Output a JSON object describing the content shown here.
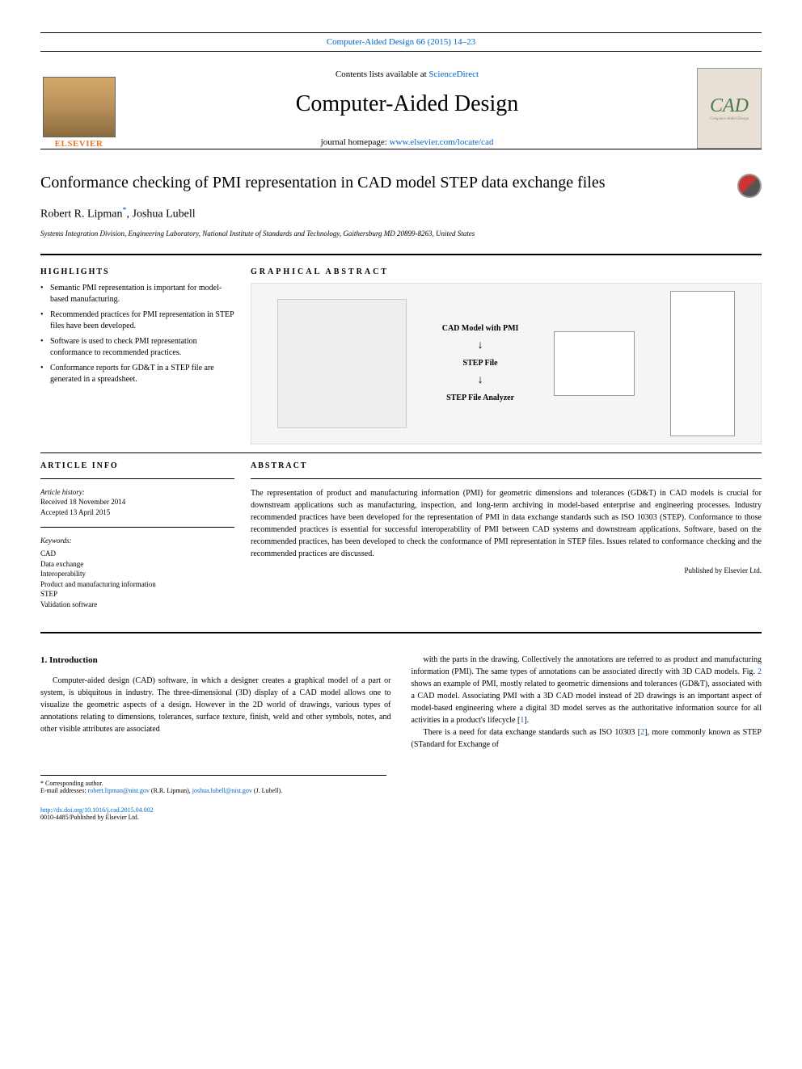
{
  "header": {
    "citation": "Computer-Aided Design 66 (2015) 14–23",
    "contents_prefix": "Contents lists available at ",
    "contents_link": "ScienceDirect",
    "journal_title": "Computer-Aided Design",
    "homepage_prefix": "journal homepage: ",
    "homepage_link": "www.elsevier.com/locate/cad",
    "elsevier_label": "ELSEVIER",
    "cad_logo": "CAD"
  },
  "article": {
    "title": "Conformance checking of PMI representation in CAD model STEP data exchange files",
    "authors": "Robert R. Lipman",
    "corr_mark": "*",
    "author2": ", Joshua Lubell",
    "affiliation": "Systems Integration Division, Engineering Laboratory, National Institute of Standards and Technology, Gaithersburg MD 20899-8263, United States"
  },
  "highlights": {
    "title": "HIGHLIGHTS",
    "items": [
      "Semantic PMI representation is important for model-based manufacturing.",
      "Recommended practices for PMI representation in STEP files have been developed.",
      "Software is used to check PMI representation conformance to recommended practices.",
      "Conformance reports for GD&T in a STEP file are generated in a spreadsheet."
    ]
  },
  "graphical_abstract": {
    "title": "GRAPHICAL ABSTRACT",
    "flow": {
      "step1": "CAD Model with PMI",
      "step2": "STEP File",
      "step3": "STEP File Analyzer"
    }
  },
  "article_info": {
    "title": "ARTICLE INFO",
    "history_label": "Article history:",
    "received": "Received 18 November 2014",
    "accepted": "Accepted 13 April 2015",
    "keywords_label": "Keywords:",
    "keywords": [
      "CAD",
      "Data exchange",
      "Interoperability",
      "Product and manufacturing information",
      "STEP",
      "Validation software"
    ]
  },
  "abstract": {
    "title": "ABSTRACT",
    "text": "The representation of product and manufacturing information (PMI) for geometric dimensions and tolerances (GD&T) in CAD models is crucial for downstream applications such as manufacturing, inspection, and long-term archiving in model-based enterprise and engineering processes. Industry recommended practices have been developed for the representation of PMI in data exchange standards such as ISO 10303 (STEP). Conformance to those recommended practices is essential for successful interoperability of PMI between CAD systems and downstream applications. Software, based on the recommended practices, has been developed to check the conformance of PMI representation in STEP files. Issues related to conformance checking and the recommended practices are discussed.",
    "copyright": "Published by Elsevier Ltd."
  },
  "body": {
    "section1_title": "1. Introduction",
    "para1": "Computer-aided design (CAD) software, in which a designer creates a graphical model of a part or system, is ubiquitous in industry. The three-dimensional (3D) display of a CAD model allows one to visualize the geometric aspects of a design. However in the 2D world of drawings, various types of annotations relating to dimensions, tolerances, surface texture, finish, weld and other symbols, notes, and other visible attributes are associated",
    "ref1": "1",
    "para2": "with the parts in the drawing. Collectively the annotations are referred to as product and manufacturing information (PMI). The same types of annotations can be associated directly with 3D CAD models.",
    "ref2": "2",
    "para2b": " shows an example of PMI, mostly related to geometric dimensions and tolerances (GD&T), associated with a CAD model. Associating PMI with a 3D CAD model instead of 2D drawings is an important aspect of model-based engineering where a digital 3D model serves as the authoritative information source for all activities in a product's lifecycle [",
    "ref3": "1",
    "para2c": "].",
    "para3": "There is a need for data exchange standards such as ISO 10303 [",
    "ref4": "2",
    "para3b": "], more commonly known as STEP (STandard for Exchange of"
  },
  "footnotes": {
    "corr": "* Corresponding author.",
    "email_label": "E-mail addresses: ",
    "email1": "robert.lipman@nist.gov",
    "email1_name": " (R.R. Lipman), ",
    "email2": "joshua.lubell@nist.gov",
    "email2_name": " (J. Lubell)."
  },
  "footer": {
    "doi": "http://dx.doi.org/10.1016/j.cad.2015.04.002",
    "copyright": "0010-4485/Published by Elsevier Ltd."
  }
}
